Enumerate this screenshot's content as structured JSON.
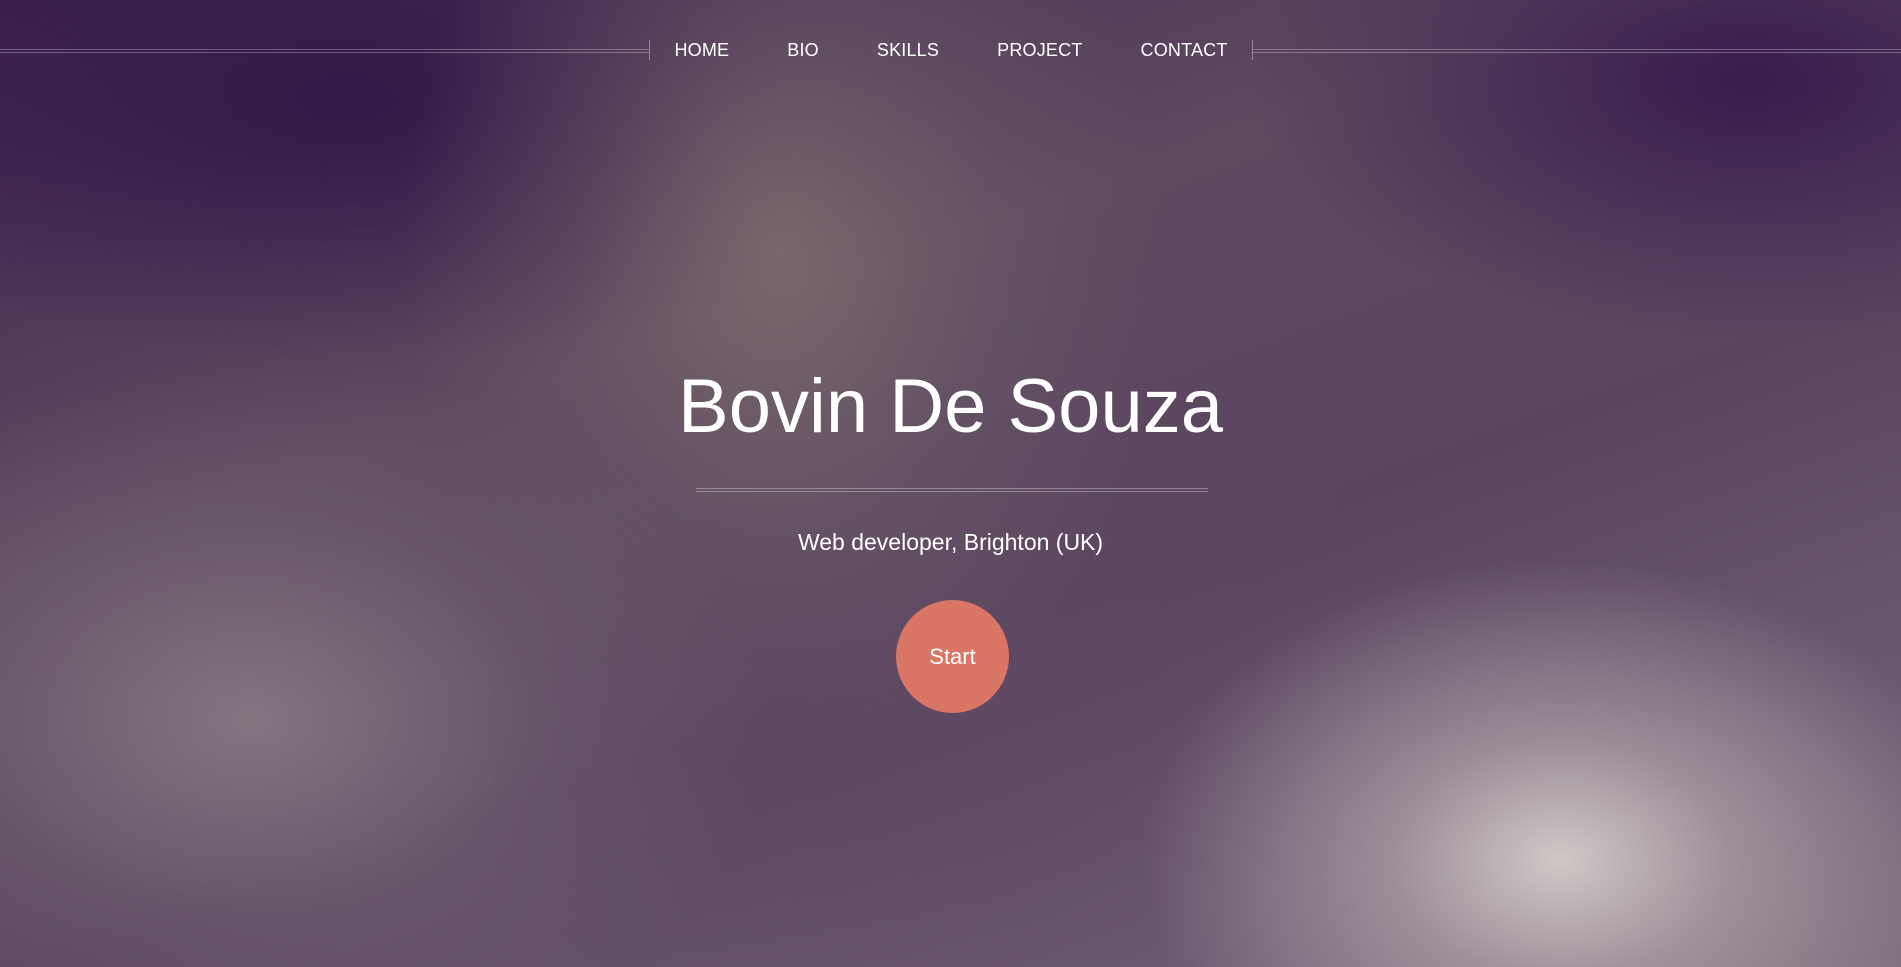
{
  "nav": {
    "items": [
      {
        "label": "HOME"
      },
      {
        "label": "BIO"
      },
      {
        "label": "SKILLS"
      },
      {
        "label": "PROJECT"
      },
      {
        "label": "CONTACT"
      }
    ]
  },
  "hero": {
    "title": "Bovin De Souza",
    "subtitle": "Web developer, Brighton (UK)",
    "start_label": "Start"
  },
  "colors": {
    "accent": "#d97666",
    "text": "#ffffff",
    "background_dark": "#3e2150",
    "background_light": "#d6cecc"
  }
}
